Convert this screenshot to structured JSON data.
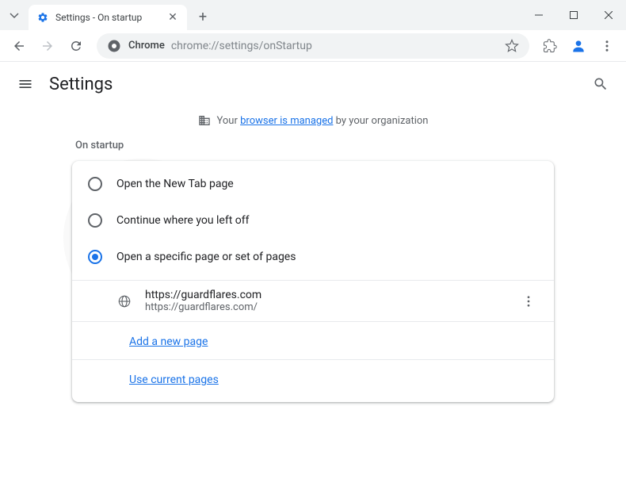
{
  "tab": {
    "title": "Settings - On startup"
  },
  "omnibox": {
    "label": "Chrome",
    "url": "chrome://settings/onStartup"
  },
  "header": {
    "title": "Settings"
  },
  "managed": {
    "prefix": "Your ",
    "link": "browser is managed",
    "suffix": " by your organization"
  },
  "section": {
    "label": "On startup"
  },
  "radios": {
    "newtab": "Open the New Tab page",
    "continue": "Continue where you left off",
    "specific": "Open a specific page or set of pages"
  },
  "startup_page": {
    "title": "https://guardflares.com",
    "url": "https://guardflares.com/"
  },
  "links": {
    "add": "Add a new page",
    "current": "Use current pages"
  }
}
